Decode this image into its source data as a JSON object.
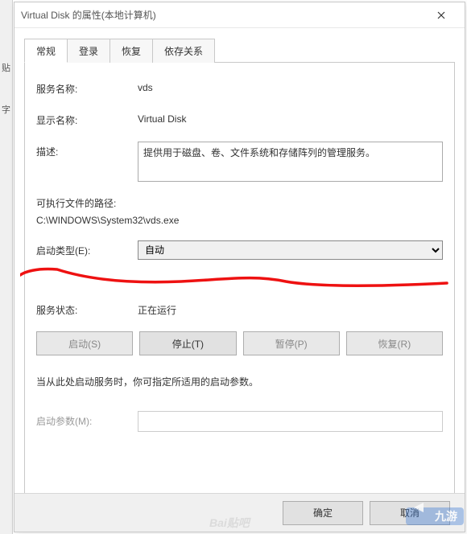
{
  "left_strip": {
    "item1": "贴",
    "item2": "字"
  },
  "window": {
    "title": "Virtual Disk 的属性(本地计算机)"
  },
  "tabs": {
    "general": "常规",
    "logon": "登录",
    "recovery": "恢复",
    "dependencies": "依存关系"
  },
  "general": {
    "service_name_label": "服务名称:",
    "service_name_value": "vds",
    "display_name_label": "显示名称:",
    "display_name_value": "Virtual Disk",
    "description_label": "描述:",
    "description_value": "提供用于磁盘、卷、文件系统和存储阵列的管理服务。",
    "exe_path_label": "可执行文件的路径:",
    "exe_path_value": "C:\\WINDOWS\\System32\\vds.exe",
    "startup_type_label": "启动类型(E):",
    "startup_type_value": "自动",
    "service_status_label": "服务状态:",
    "service_status_value": "正在运行",
    "hint_text": "当从此处启动服务时，你可指定所适用的启动参数。",
    "start_params_label": "启动参数(M):",
    "start_params_value": ""
  },
  "buttons": {
    "start": "启动(S)",
    "stop": "停止(T)",
    "pause": "暂停(P)",
    "resume": "恢复(R)",
    "ok": "确定",
    "cancel": "取消"
  },
  "watermark": {
    "jy_text": "九游",
    "baidu": "Bai贴吧"
  }
}
